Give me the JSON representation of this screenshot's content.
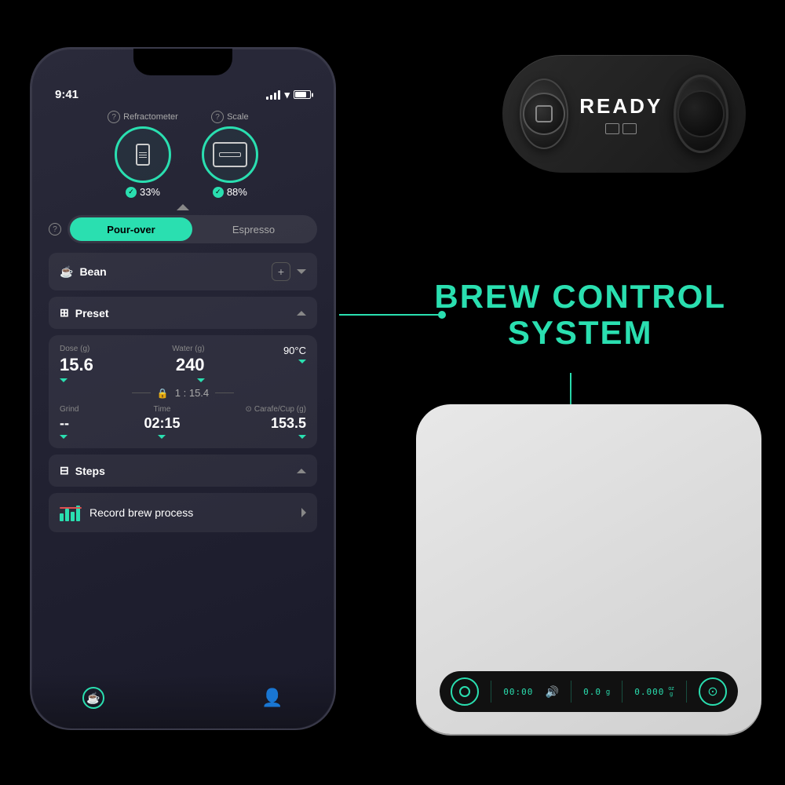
{
  "phone": {
    "statusBar": {
      "time": "9:41",
      "signal": "signal",
      "wifi": "wifi",
      "battery": "battery"
    },
    "sensors": {
      "refractometerLabel": "Refractometer",
      "scaleLabel": "Scale",
      "refractPct": "33%",
      "scalePct": "88%"
    },
    "brewToggle": {
      "pourover": "Pour-over",
      "espresso": "Espresso"
    },
    "bean": {
      "label": "Bean",
      "addLabel": "+"
    },
    "preset": {
      "label": "Preset",
      "doseLabel": "Dose (g)",
      "doseValue": "15.6",
      "waterLabel": "Water (g)",
      "waterValue": "240",
      "tempValue": "90°C",
      "ratio": "1 : 15.4",
      "grindLabel": "Grind",
      "grindValue": "--",
      "timeLabel": "Time",
      "timeValue": "02:15",
      "carafeLabel": "Carafe/Cup (g)",
      "carafeValue": "153.5"
    },
    "steps": {
      "label": "Steps",
      "recordLabel": "Record brew process"
    },
    "bottomNav": {
      "brewIcon": "☕",
      "profileIcon": "👤"
    }
  },
  "bcs": {
    "title": "BREW CONTROL",
    "title2": "SYSTEM"
  },
  "refractDevice": {
    "readyText": "READY"
  },
  "scaleDevice": {
    "time": "00:00",
    "weight1": "0.0",
    "weight2": "0.000"
  }
}
